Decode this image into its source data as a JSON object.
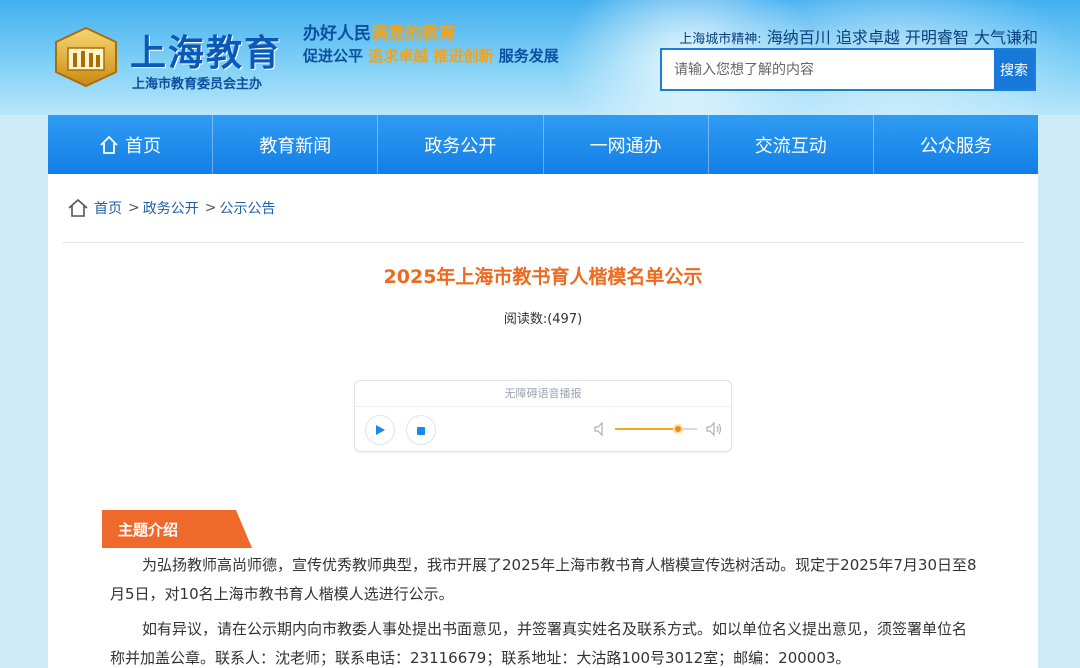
{
  "header": {
    "logo_title": "上海教育",
    "logo_subtitle": "上海市教育委员会主办",
    "slogan_line1_a": "办好人民",
    "slogan_line1_b": "满意的教育",
    "slogan_line2_a": "促进公平",
    "slogan_line2_b": "追求卓越",
    "slogan_line2_c": "推进创新",
    "slogan_line2_d": "服务发展",
    "spirit_label": "上海城市精神:",
    "spirit_text": "海纳百川 追求卓越 开明睿智 大气谦和",
    "search_placeholder": "请输入您想了解的内容",
    "search_button": "搜索"
  },
  "nav": {
    "items": [
      {
        "label": "首页"
      },
      {
        "label": "教育新闻"
      },
      {
        "label": "政务公开"
      },
      {
        "label": "一网通办"
      },
      {
        "label": "交流互动"
      },
      {
        "label": "公众服务"
      }
    ]
  },
  "breadcrumb": {
    "home": "首页",
    "level1": "政务公开",
    "level2": "公示公告",
    "separator": ">"
  },
  "article": {
    "title": "2025年上海市教书育人楷模名单公示",
    "read_count": "阅读数:(497)",
    "section_label": "主题介绍",
    "paragraph1": "为弘扬教师高尚师德，宣传优秀教师典型，我市开展了2025年上海市教书育人楷模宣传选树活动。现定于2025年7月30日至8月5日，对10名上海市教书育人楷模人选进行公示。",
    "paragraph2": "如有异议，请在公示期内向市教委人事处提出书面意见，并签署真实姓名及联系方式。如以单位名义提出意见，须签署单位名称并加盖公章。联系人：沈老师；联系电话：23116679；联系地址：大沽路100号3012室；邮编：200003。"
  },
  "player": {
    "title": "无障碍语音播报",
    "volume": 0.77
  },
  "colors": {
    "nav_blue": "#137ee6",
    "title_orange": "#ee6a1e",
    "section_orange": "#ef6a2a",
    "link_blue": "#1f5fa8"
  }
}
